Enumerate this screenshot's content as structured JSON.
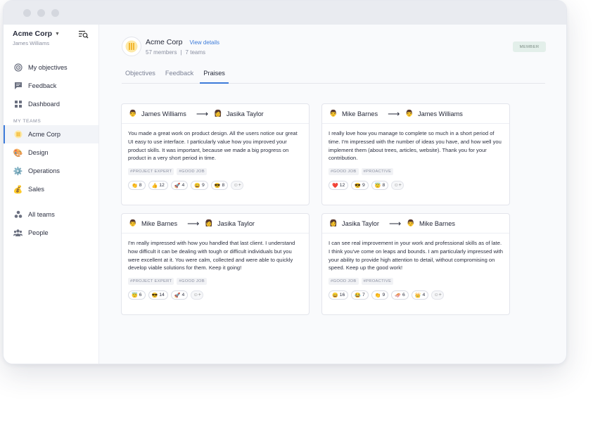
{
  "sidebar": {
    "org_name": "Acme Corp",
    "user_name": "James Williams",
    "items": [
      {
        "label": "My objectives",
        "icon": "target-icon"
      },
      {
        "label": "Feedback",
        "icon": "chat-icon"
      },
      {
        "label": "Dashboard",
        "icon": "grid-icon"
      }
    ],
    "teams_label": "MY TEAMS",
    "teams": [
      {
        "label": "Acme Corp",
        "icon": "building-icon",
        "active": true
      },
      {
        "label": "Design",
        "icon": "palette-icon"
      },
      {
        "label": "Operations",
        "icon": "gear-icon"
      },
      {
        "label": "Sales",
        "icon": "money-bag-icon"
      }
    ],
    "bottom": [
      {
        "label": "All teams",
        "icon": "teams-icon"
      },
      {
        "label": "People",
        "icon": "people-icon"
      }
    ]
  },
  "header": {
    "org_title": "Acme Corp",
    "view_details": "View details",
    "members": "57 members",
    "teams": "7 teams",
    "badge": "MEMBER"
  },
  "tabs": [
    "Objectives",
    "Feedback",
    "Praises"
  ],
  "active_tab": "Praises",
  "praises": [
    {
      "from": "James Williams",
      "to": "Jasika Taylor",
      "message": "You made a great work on product design. All the users notice our great UI easy to use interface. I particularly value how you improved your product skills. It was important, because we made a big progress on product in a very short period in time.",
      "tags": [
        "#PROJECT EXPERT",
        "#GOOD JOB"
      ],
      "reactions": [
        {
          "emoji": "👏",
          "count": "8"
        },
        {
          "emoji": "👍",
          "count": "12"
        },
        {
          "emoji": "🚀",
          "count": "4"
        },
        {
          "emoji": "😄",
          "count": "9"
        },
        {
          "emoji": "😎",
          "count": "8"
        }
      ]
    },
    {
      "from": "Mike Barnes",
      "to": "James Williams",
      "message": "I really love how you manage to complete so much in a short period of time. I'm impressed with the number of ideas you have, and how well you implement them (about trees, articles, website). Thank you for your contribution.",
      "tags": [
        "#GOOD JOB",
        "#PROACTIVE"
      ],
      "reactions": [
        {
          "emoji": "❤️",
          "count": "12"
        },
        {
          "emoji": "😎",
          "count": "9"
        },
        {
          "emoji": "😇",
          "count": "8"
        }
      ]
    },
    {
      "from": "Mike Barnes",
      "to": "Jasika Taylor",
      "message": "I'm really impressed with how you handled that last client. I understand how difficult it can be dealing with tough or difficult individuals but you were excellent at it. You were calm, collected and were able to quickly develop viable solutions for them. Keep it going!",
      "tags": [
        "#PROJECT EXPERT",
        "#GOOD JOB"
      ],
      "reactions": [
        {
          "emoji": "😇",
          "count": "6"
        },
        {
          "emoji": "😎",
          "count": "14"
        },
        {
          "emoji": "🚀",
          "count": "4"
        }
      ]
    },
    {
      "from": "Jasika Taylor",
      "to": "Mike Barnes",
      "message": "I can see real improvement in your work and professional skills as of late. I think you've come on leaps and bounds. I am particularly impressed with your ability to provide high attention to detail, without compromising on speed. Keep up the good work!",
      "tags": [
        "#GOOD JOB",
        "#PROACTIVE"
      ],
      "reactions": [
        {
          "emoji": "😄",
          "count": "16"
        },
        {
          "emoji": "😂",
          "count": "7"
        },
        {
          "emoji": "👏",
          "count": "9"
        },
        {
          "emoji": "🛷",
          "count": "6"
        },
        {
          "emoji": "👑",
          "count": "4"
        }
      ]
    }
  ],
  "colors": {
    "accent": "#3d7bd9",
    "badge_bg": "#e3efea"
  }
}
